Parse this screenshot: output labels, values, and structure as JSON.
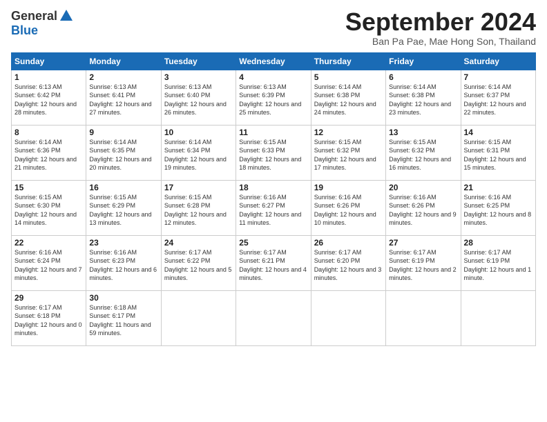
{
  "logo": {
    "general": "General",
    "blue": "Blue"
  },
  "title": "September 2024",
  "location": "Ban Pa Pae, Mae Hong Son, Thailand",
  "weekdays": [
    "Sunday",
    "Monday",
    "Tuesday",
    "Wednesday",
    "Thursday",
    "Friday",
    "Saturday"
  ],
  "weeks": [
    [
      {
        "day": "1",
        "sunrise": "6:13 AM",
        "sunset": "6:42 PM",
        "daylight": "12 hours and 28 minutes."
      },
      {
        "day": "2",
        "sunrise": "6:13 AM",
        "sunset": "6:41 PM",
        "daylight": "12 hours and 27 minutes."
      },
      {
        "day": "3",
        "sunrise": "6:13 AM",
        "sunset": "6:40 PM",
        "daylight": "12 hours and 26 minutes."
      },
      {
        "day": "4",
        "sunrise": "6:13 AM",
        "sunset": "6:39 PM",
        "daylight": "12 hours and 25 minutes."
      },
      {
        "day": "5",
        "sunrise": "6:14 AM",
        "sunset": "6:38 PM",
        "daylight": "12 hours and 24 minutes."
      },
      {
        "day": "6",
        "sunrise": "6:14 AM",
        "sunset": "6:38 PM",
        "daylight": "12 hours and 23 minutes."
      },
      {
        "day": "7",
        "sunrise": "6:14 AM",
        "sunset": "6:37 PM",
        "daylight": "12 hours and 22 minutes."
      }
    ],
    [
      {
        "day": "8",
        "sunrise": "6:14 AM",
        "sunset": "6:36 PM",
        "daylight": "12 hours and 21 minutes."
      },
      {
        "day": "9",
        "sunrise": "6:14 AM",
        "sunset": "6:35 PM",
        "daylight": "12 hours and 20 minutes."
      },
      {
        "day": "10",
        "sunrise": "6:14 AM",
        "sunset": "6:34 PM",
        "daylight": "12 hours and 19 minutes."
      },
      {
        "day": "11",
        "sunrise": "6:15 AM",
        "sunset": "6:33 PM",
        "daylight": "12 hours and 18 minutes."
      },
      {
        "day": "12",
        "sunrise": "6:15 AM",
        "sunset": "6:32 PM",
        "daylight": "12 hours and 17 minutes."
      },
      {
        "day": "13",
        "sunrise": "6:15 AM",
        "sunset": "6:32 PM",
        "daylight": "12 hours and 16 minutes."
      },
      {
        "day": "14",
        "sunrise": "6:15 AM",
        "sunset": "6:31 PM",
        "daylight": "12 hours and 15 minutes."
      }
    ],
    [
      {
        "day": "15",
        "sunrise": "6:15 AM",
        "sunset": "6:30 PM",
        "daylight": "12 hours and 14 minutes."
      },
      {
        "day": "16",
        "sunrise": "6:15 AM",
        "sunset": "6:29 PM",
        "daylight": "12 hours and 13 minutes."
      },
      {
        "day": "17",
        "sunrise": "6:15 AM",
        "sunset": "6:28 PM",
        "daylight": "12 hours and 12 minutes."
      },
      {
        "day": "18",
        "sunrise": "6:16 AM",
        "sunset": "6:27 PM",
        "daylight": "12 hours and 11 minutes."
      },
      {
        "day": "19",
        "sunrise": "6:16 AM",
        "sunset": "6:26 PM",
        "daylight": "12 hours and 10 minutes."
      },
      {
        "day": "20",
        "sunrise": "6:16 AM",
        "sunset": "6:26 PM",
        "daylight": "12 hours and 9 minutes."
      },
      {
        "day": "21",
        "sunrise": "6:16 AM",
        "sunset": "6:25 PM",
        "daylight": "12 hours and 8 minutes."
      }
    ],
    [
      {
        "day": "22",
        "sunrise": "6:16 AM",
        "sunset": "6:24 PM",
        "daylight": "12 hours and 7 minutes."
      },
      {
        "day": "23",
        "sunrise": "6:16 AM",
        "sunset": "6:23 PM",
        "daylight": "12 hours and 6 minutes."
      },
      {
        "day": "24",
        "sunrise": "6:17 AM",
        "sunset": "6:22 PM",
        "daylight": "12 hours and 5 minutes."
      },
      {
        "day": "25",
        "sunrise": "6:17 AM",
        "sunset": "6:21 PM",
        "daylight": "12 hours and 4 minutes."
      },
      {
        "day": "26",
        "sunrise": "6:17 AM",
        "sunset": "6:20 PM",
        "daylight": "12 hours and 3 minutes."
      },
      {
        "day": "27",
        "sunrise": "6:17 AM",
        "sunset": "6:19 PM",
        "daylight": "12 hours and 2 minutes."
      },
      {
        "day": "28",
        "sunrise": "6:17 AM",
        "sunset": "6:19 PM",
        "daylight": "12 hours and 1 minute."
      }
    ],
    [
      {
        "day": "29",
        "sunrise": "6:17 AM",
        "sunset": "6:18 PM",
        "daylight": "12 hours and 0 minutes."
      },
      {
        "day": "30",
        "sunrise": "6:18 AM",
        "sunset": "6:17 PM",
        "daylight": "11 hours and 59 minutes."
      },
      null,
      null,
      null,
      null,
      null
    ]
  ]
}
